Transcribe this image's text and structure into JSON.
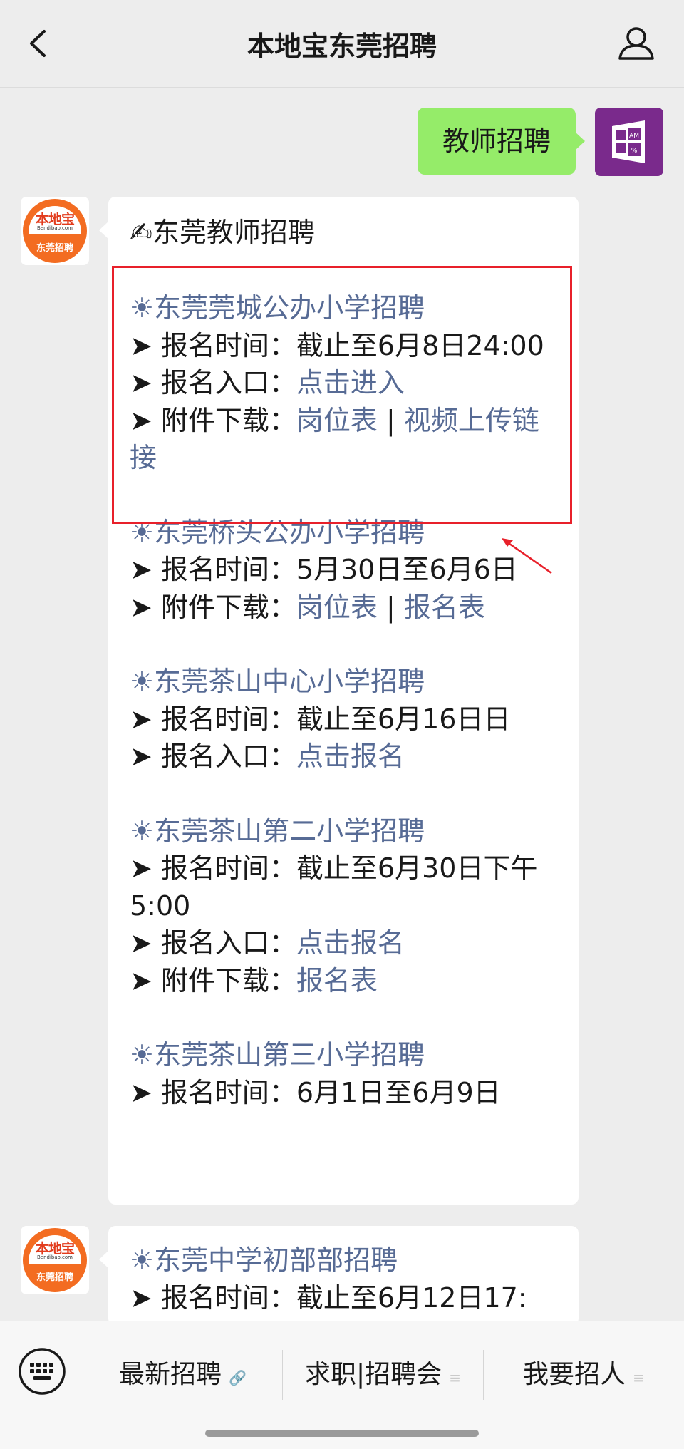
{
  "header": {
    "title": "本地宝东莞招聘"
  },
  "user_message": {
    "text": "教师招聘"
  },
  "bot_avatar": {
    "logo_main": "本地宝",
    "logo_sub": "Bendibao.com",
    "logo_bottom": "东莞招聘"
  },
  "message1": {
    "heading": "✍东莞教师招聘",
    "sections": [
      {
        "title": "☀东莞莞城公办小学招聘",
        "lines": [
          {
            "label": "➤ 报名时间：",
            "value": "截止至6月8日24:00"
          },
          {
            "label": "➤ 报名入口：",
            "link": "点击进入"
          },
          {
            "label": "➤ 附件下载：",
            "link": "岗位表",
            "sep": " | ",
            "link2": "视频上传链接"
          }
        ]
      },
      {
        "title": "☀东莞桥头公办小学招聘",
        "lines": [
          {
            "label": "➤ 报名时间：",
            "value": "5月30日至6月6日"
          },
          {
            "label": "➤ 附件下载：",
            "link": "岗位表",
            "sep": " | ",
            "link2": "报名表"
          }
        ]
      },
      {
        "title": "☀东莞茶山中心小学招聘",
        "lines": [
          {
            "label": "➤ 报名时间：",
            "value": "截止至6月16日日"
          },
          {
            "label": "➤ 报名入口：",
            "link": "点击报名"
          }
        ]
      },
      {
        "title": "☀东莞茶山第二小学招聘",
        "lines": [
          {
            "label": "➤ 报名时间：",
            "value": "截止至6月30日下午5:00"
          },
          {
            "label": "➤ 报名入口：",
            "link": "点击报名"
          },
          {
            "label": "➤ 附件下载：",
            "link": "报名表"
          }
        ]
      },
      {
        "title": "☀东莞茶山第三小学招聘",
        "lines": [
          {
            "label": "➤ 报名时间：",
            "value": "6月1日至6月9日"
          }
        ]
      }
    ]
  },
  "message2": {
    "title": "☀东莞中学初部部招聘",
    "lines": [
      {
        "label": "➤ 报名时间：",
        "value": "截止至6月12日17:"
      }
    ]
  },
  "menu": {
    "items": [
      {
        "label": "最新招聘",
        "icon": "link-icon"
      },
      {
        "label": "求职|招聘会",
        "icon": "menu-icon"
      },
      {
        "label": "我要招人",
        "icon": "menu-icon"
      }
    ]
  },
  "colors": {
    "link": "#576b95",
    "user_bubble": "#95ec69",
    "highlight": "#e8202a",
    "background": "#ededed"
  }
}
